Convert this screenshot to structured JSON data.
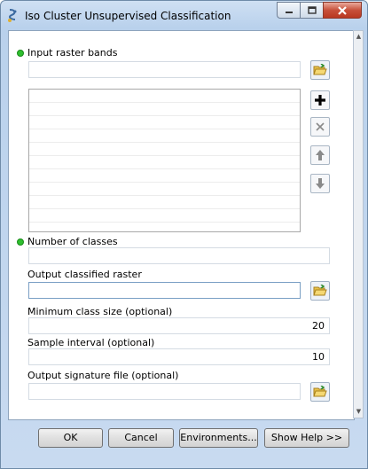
{
  "window": {
    "title": "Iso Cluster Unsupervised Classification",
    "icon": "python-tool-icon"
  },
  "fields": {
    "input_raster_bands": {
      "label": "Input raster bands",
      "value": "",
      "required": true
    },
    "number_of_classes": {
      "label": "Number of classes",
      "value": "",
      "required": true
    },
    "output_classified_raster": {
      "label": "Output classified raster",
      "value": ""
    },
    "min_class_size": {
      "label": "Minimum class size (optional)",
      "value": "20"
    },
    "sample_interval": {
      "label": "Sample interval (optional)",
      "value": "10"
    },
    "output_signature_file": {
      "label": "Output signature file (optional)",
      "value": ""
    }
  },
  "list": {
    "items": []
  },
  "list_buttons": {
    "add": "add-icon",
    "remove": "delete-icon",
    "up": "arrow-up-icon",
    "down": "arrow-down-icon"
  },
  "buttons": {
    "ok": "OK",
    "cancel": "Cancel",
    "environments": "Environments...",
    "show_help": "Show Help >>"
  },
  "colors": {
    "required_dot": "#2fbf2f",
    "title_bar": "#b9d1ec",
    "close_button": "#c7503a"
  }
}
